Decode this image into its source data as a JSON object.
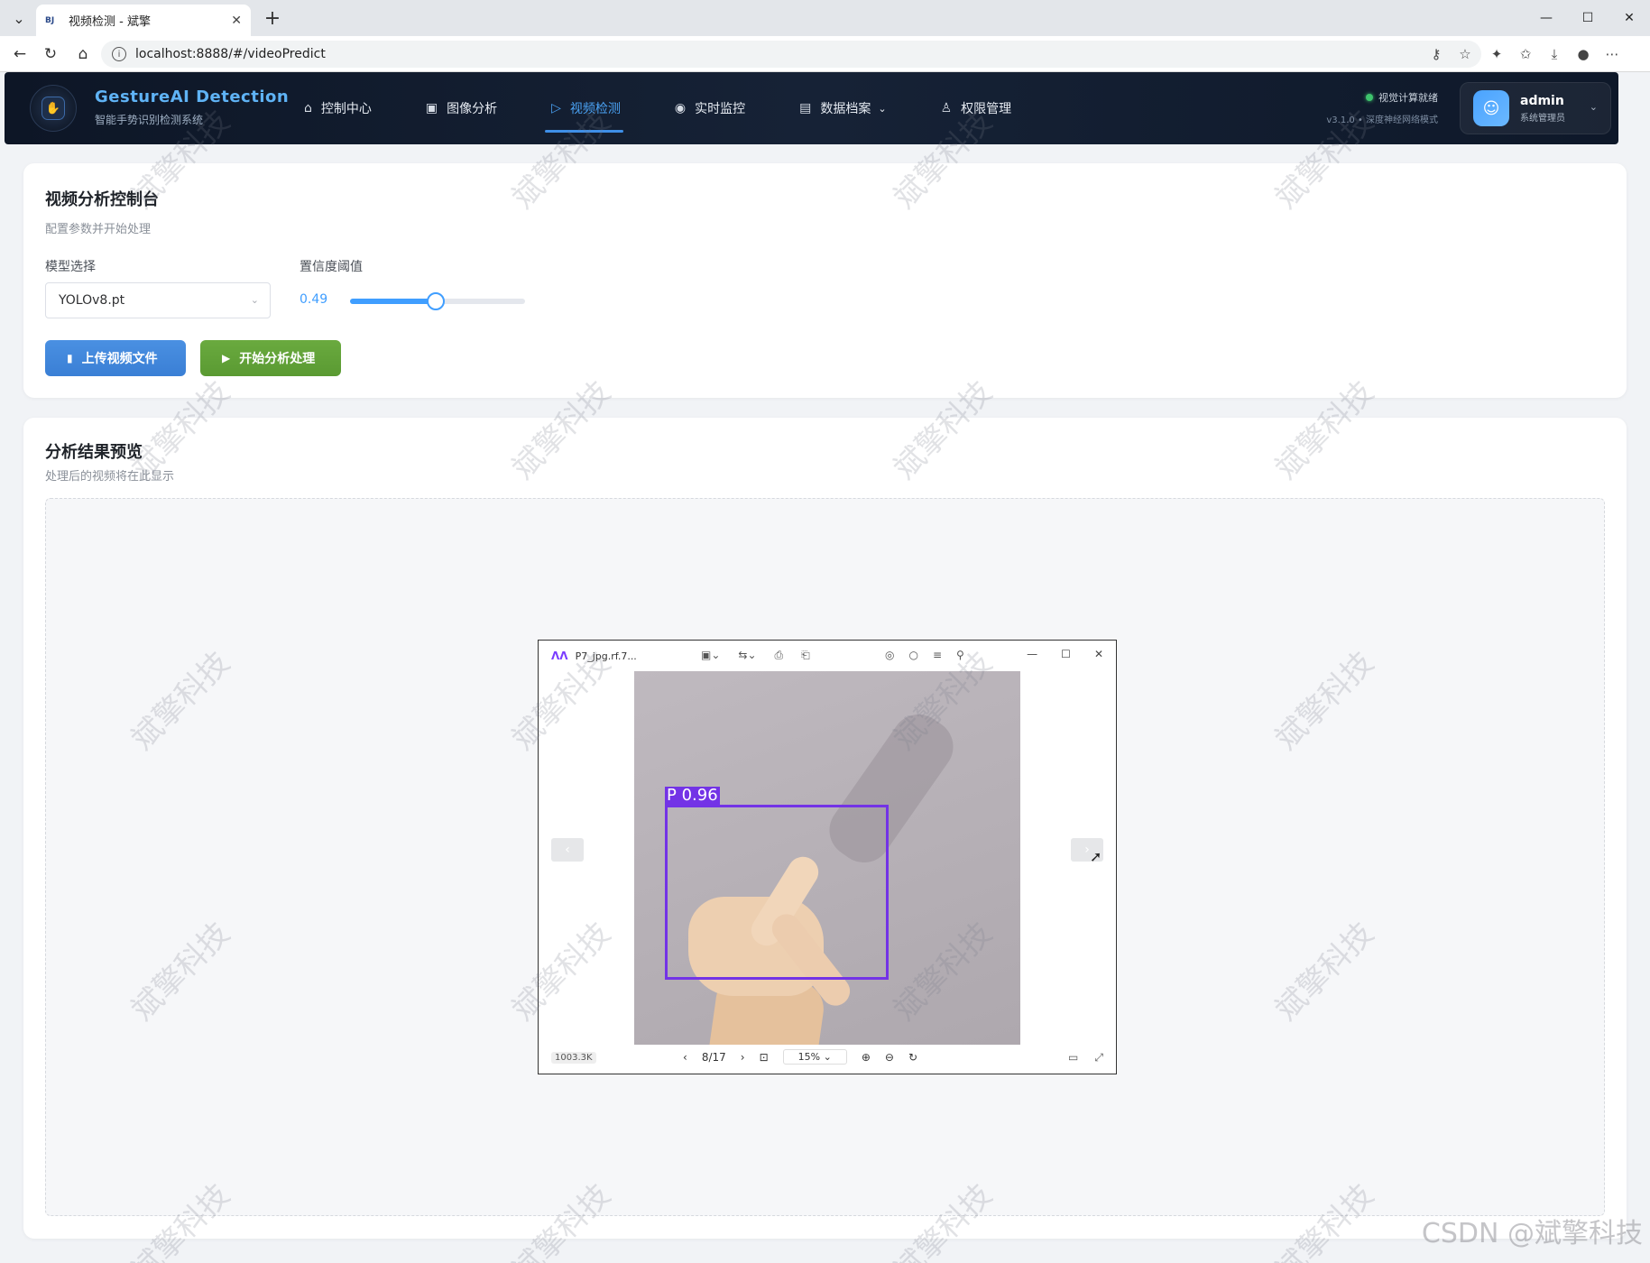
{
  "browser": {
    "tab_title": "视频检测 - 斌擎",
    "favicon": "BJ",
    "url": "localhost:8888/#/videoPredict"
  },
  "header": {
    "brand_title": "GestureAI Detection",
    "brand_subtitle": "智能手势识别检测系统",
    "menu": [
      {
        "label": "控制中心",
        "icon": "home-icon"
      },
      {
        "label": "图像分析",
        "icon": "image-icon"
      },
      {
        "label": "视频检测",
        "icon": "play-circle-icon"
      },
      {
        "label": "实时监控",
        "icon": "camera-icon"
      },
      {
        "label": "数据档案",
        "icon": "document-icon"
      },
      {
        "label": "权限管理",
        "icon": "user-icon"
      }
    ],
    "active_menu": "视频检测",
    "status_text": "视觉计算就绪",
    "version_text": "v3.1.0 • 深度神经网络模式",
    "user_name": "admin",
    "user_role": "系统管理员"
  },
  "control_panel": {
    "title": "视频分析控制台",
    "subtitle": "配置参数并开始处理",
    "model_label": "模型选择",
    "model_value": "YOLOv8.pt",
    "confidence_label": "置信度阈值",
    "confidence_value": "0.49",
    "confidence_fraction": 0.49,
    "upload_button": "上传视频文件",
    "start_button": "开始分析处理"
  },
  "result_panel": {
    "title": "分析结果预览",
    "subtitle": "处理后的视频将在此显示"
  },
  "viewer": {
    "file_name": "P7_jpg.rf.7...",
    "detection_label": "P  0.96",
    "file_size": "1003.3K",
    "page": "8/17",
    "zoom": "15%"
  },
  "watermark_text": "斌擎科技",
  "csdn_watermark": "CSDN @斌擎科技",
  "colors": {
    "accent": "#409eff",
    "header_bg": "#0d1626",
    "upload_button": "#4a90e2",
    "start_button": "#6aaa3f",
    "bbox": "#7333e6"
  }
}
